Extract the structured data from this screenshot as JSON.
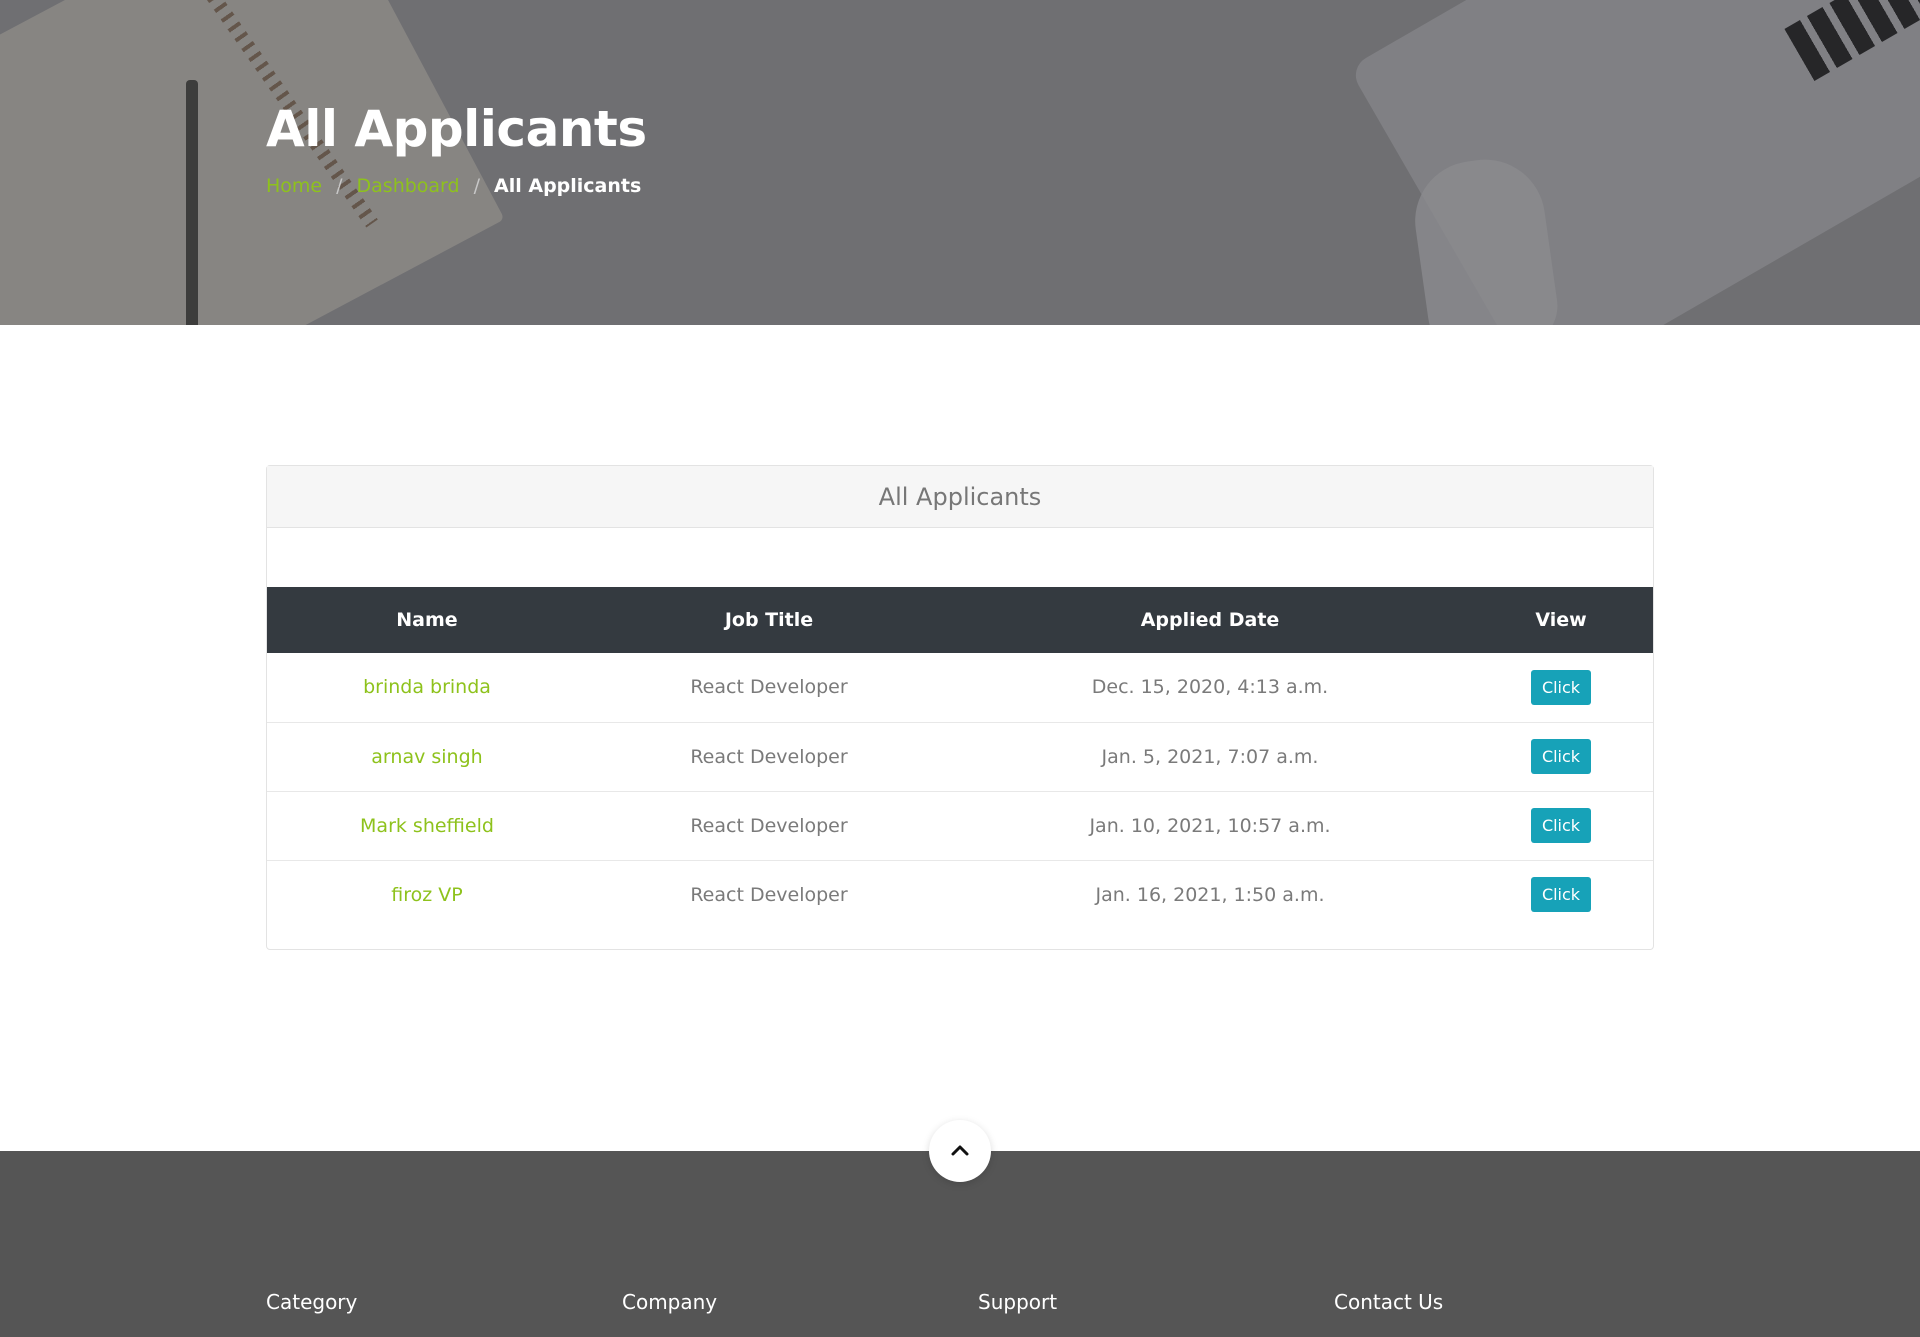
{
  "hero": {
    "title": "All Applicants",
    "breadcrumb": {
      "home": "Home",
      "separator": "/",
      "dashboard": "Dashboard",
      "current": "All Applicants"
    }
  },
  "card": {
    "title": "All Applicants",
    "columns": [
      "Name",
      "Job Title",
      "Applied Date",
      "View"
    ],
    "rows": [
      {
        "name": "brinda brinda",
        "job_title": "React Developer",
        "applied_date": "Dec. 15, 2020, 4:13 a.m.",
        "action": "Click"
      },
      {
        "name": "arnav singh",
        "job_title": "React Developer",
        "applied_date": "Jan. 5, 2021, 7:07 a.m.",
        "action": "Click"
      },
      {
        "name": "Mark sheffield",
        "job_title": "React Developer",
        "applied_date": "Jan. 10, 2021, 10:57 a.m.",
        "action": "Click"
      },
      {
        "name": "firoz VP",
        "job_title": "React Developer",
        "applied_date": "Jan. 16, 2021, 1:50 a.m.",
        "action": "Click"
      }
    ]
  },
  "footer": {
    "columns": [
      "Category",
      "Company",
      "Support",
      "Contact Us"
    ]
  },
  "scroll_top_icon": "chevron-up-icon",
  "colors": {
    "accent_green": "#8ec21c",
    "button_teal": "#17a2b8",
    "table_header": "#343a40",
    "footer_bg": "#555555",
    "hero_overlay": "#6f6f72"
  }
}
